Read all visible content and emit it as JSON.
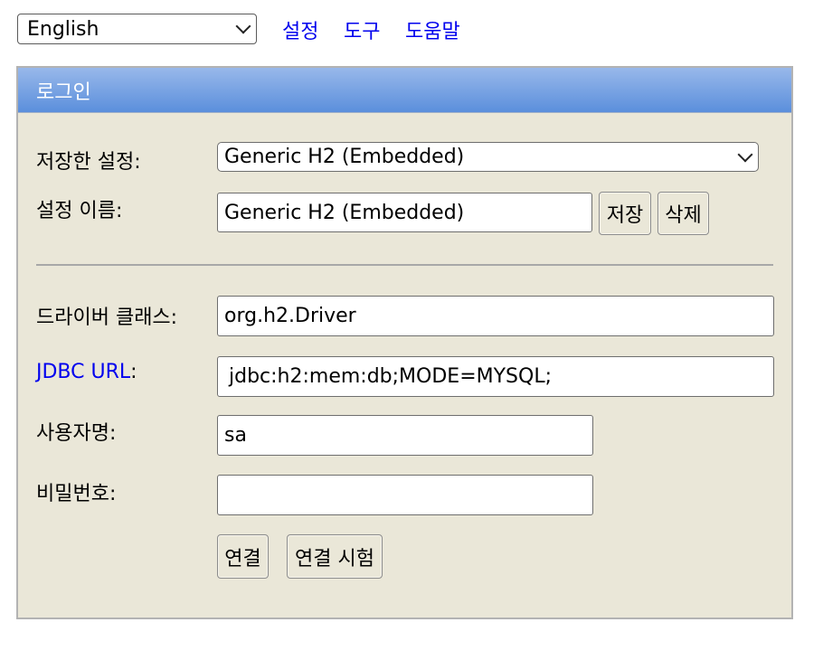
{
  "top": {
    "language_value": "English",
    "links": [
      "설정",
      "도구",
      "도움말"
    ]
  },
  "login": {
    "header": "로그인",
    "saved_settings_label": "저장한 설정:",
    "saved_settings_value": "Generic H2 (Embedded)",
    "setting_name_label": "설정 이름:",
    "setting_name_value": "Generic H2 (Embedded)",
    "save_button": "저장",
    "delete_button": "삭제",
    "driver_class_label": "드라이버 클래스:",
    "driver_class_value": "org.h2.Driver",
    "jdbc_url_link": "JDBC URL",
    "jdbc_url_colon": ":",
    "jdbc_url_value": "jdbc:h2:mem:db;MODE=MYSQL;",
    "username_label": "사용자명:",
    "username_value": "sa",
    "password_label": "비밀번호:",
    "password_value": "",
    "connect_button": "연결",
    "test_connection_button": "연결 시험"
  },
  "colors": {
    "header_gradient_top": "#98b8ea",
    "header_gradient_bottom": "#5b8fdc",
    "panel_bg": "#eae7d8",
    "link": "#0000ee"
  }
}
